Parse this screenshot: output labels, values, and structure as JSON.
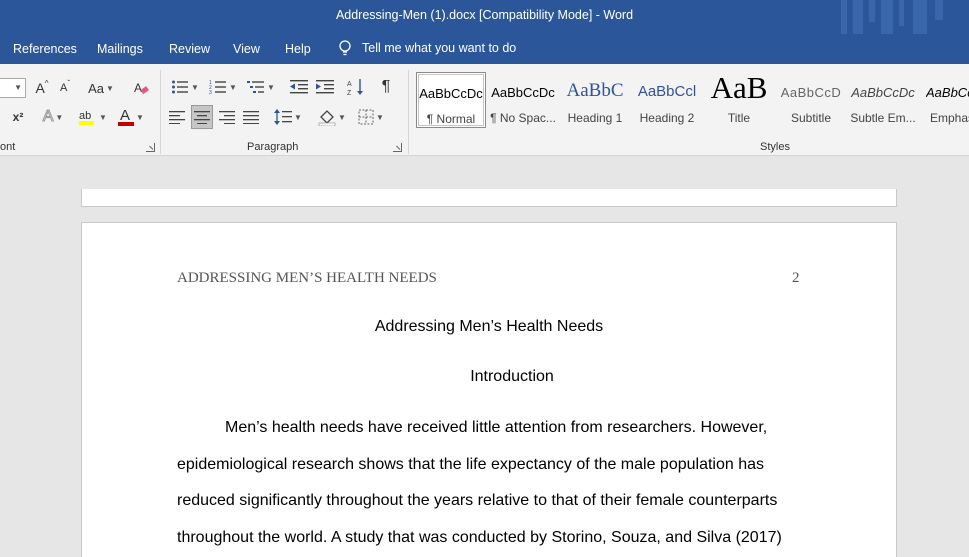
{
  "window": {
    "title": "Addressing-Men (1).docx [Compatibility Mode]  -  Word"
  },
  "menu": {
    "tabs": [
      "References",
      "Mailings",
      "Review",
      "View",
      "Help"
    ],
    "tell_me": "Tell me what you want to do"
  },
  "ribbon": {
    "font_group_label": "ont",
    "paragraph_group_label": "Paragraph",
    "styles_group_label": "Styles",
    "buttons": {
      "grow_font": "A",
      "shrink_font": "A",
      "change_case": "Aa",
      "superscript": "x²",
      "text_effects": "A",
      "font_color": "A",
      "paragraph_mark": "¶"
    },
    "styles": [
      {
        "sample": "AaBbCcDc",
        "name": "¶ Normal"
      },
      {
        "sample": "AaBbCcDc",
        "name": "¶ No Spac..."
      },
      {
        "sample": "AaBbC",
        "name": "Heading 1"
      },
      {
        "sample": "AaBbCcl",
        "name": "Heading 2"
      },
      {
        "sample": "AaB",
        "name": "Title"
      },
      {
        "sample": "AaBbCcD",
        "name": "Subtitle"
      },
      {
        "sample": "AaBbCcDc",
        "name": "Subtle Em..."
      },
      {
        "sample": "AaBbCc",
        "name": "Emphas"
      }
    ]
  },
  "colors": {
    "accent": "#2b579a",
    "highlight": "#ffff00",
    "font_color": "#c00000"
  },
  "document": {
    "running_head": "ADDRESSING MEN’S HEALTH NEEDS",
    "page_number": "2",
    "title": "Addressing Men’s Health Needs",
    "heading": "Introduction",
    "lines": [
      "Men’s health needs have received little attention from researchers. However,",
      "epidemiological research shows that the life expectancy of the male population has",
      "reduced significantly throughout the years relative to that of their female counterparts",
      "throughout the world. A study that was conducted by Storino, Souza, and Silva (2017)"
    ]
  }
}
